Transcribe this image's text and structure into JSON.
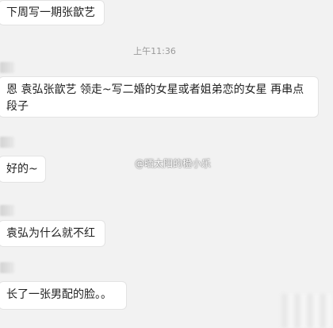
{
  "timestamp": "上午11:36",
  "watermark": "@晒太阳的橙小乐",
  "messages": [
    {
      "sender": "self",
      "text": "下周写一期张歆艺"
    },
    {
      "sender": "other",
      "text": "恩 袁弘张歆艺 领走~写二婚的女星或者姐弟恋的女星 再串点段子"
    },
    {
      "sender": "self",
      "text": "好的~"
    },
    {
      "sender": "other",
      "text": "袁弘为什么就不红"
    },
    {
      "sender": "self",
      "text": "长了一张男配的脸。。"
    }
  ]
}
